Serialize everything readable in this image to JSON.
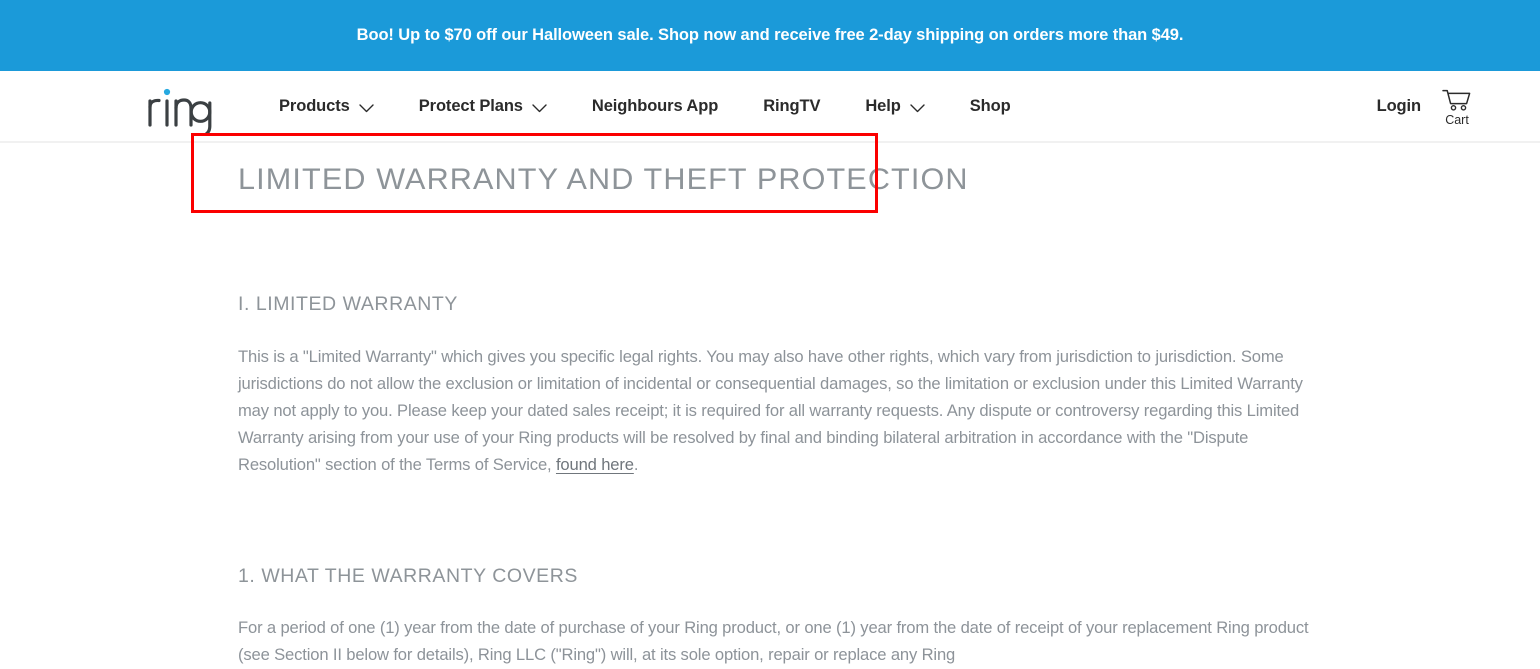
{
  "promo": {
    "text": "Boo! Up to $70 off our Halloween sale. Shop now and receive free 2-day shipping on orders more than $49.",
    "background_color": "#1b9ad9",
    "text_color": "#ffffff"
  },
  "nav": {
    "logo_text": "ring",
    "logo_dot_color": "#26a9e0",
    "items": [
      {
        "label": "Products",
        "has_dropdown": true,
        "icon": "chevron-down-icon"
      },
      {
        "label": "Protect Plans",
        "has_dropdown": true,
        "icon": "chevron-down-icon"
      },
      {
        "label": "Neighbours App",
        "has_dropdown": false
      },
      {
        "label": "RingTV",
        "has_dropdown": false
      },
      {
        "label": "Help",
        "has_dropdown": true,
        "icon": "chevron-down-icon"
      },
      {
        "label": "Shop",
        "has_dropdown": false
      }
    ],
    "login_label": "Login",
    "cart_label": "Cart",
    "cart_icon": "shopping-cart-icon"
  },
  "page": {
    "title": "LIMITED WARRANTY AND THEFT PROTECTION",
    "sections": [
      {
        "heading": "I. LIMITED WARRANTY",
        "paragraph_before_link": "This is a \"Limited Warranty\" which gives you specific legal rights. You may also have other rights, which vary from jurisdiction to jurisdiction. Some jurisdictions do not allow the exclusion or limitation of incidental or consequential damages, so the limitation or exclusion under this Limited Warranty may not apply to you. Please keep your dated sales receipt; it is required for all warranty requests. Any dispute or controversy regarding this Limited Warranty arising from your use of your Ring products will be resolved by final and binding bilateral arbitration in accordance with the \"Dispute Resolution\" section of the Terms of Service, ",
        "link_text": "found here",
        "paragraph_after_link": "."
      },
      {
        "heading": "1. WHAT THE WARRANTY COVERS",
        "paragraph": "For a period of one (1) year from the date of purchase of your Ring product, or one (1) year from the date of receipt of your replacement Ring product (see Section II below for details), Ring LLC (\"Ring\") will, at its sole option, repair or replace any Ring"
      }
    ]
  },
  "annotation": {
    "color": "#fb0000",
    "target": "page-title"
  }
}
